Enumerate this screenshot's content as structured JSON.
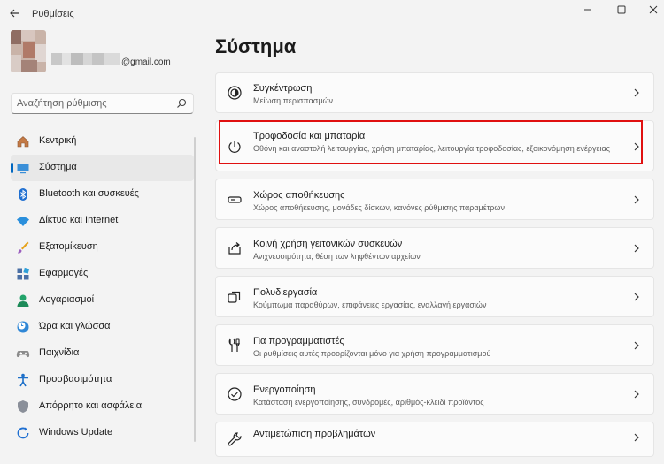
{
  "window": {
    "title": "Ρυθμίσεις",
    "back_icon": "arrow-left-icon",
    "controls": [
      "minimize-icon",
      "maximize-icon",
      "close-icon"
    ]
  },
  "profile": {
    "email": "@gmail.com"
  },
  "search": {
    "placeholder": "Αναζήτηση ρύθμισης",
    "icon": "search-icon"
  },
  "sidebar": {
    "items": [
      {
        "label": "Κεντρική",
        "icon": "home-icon"
      },
      {
        "label": "Σύστημα",
        "icon": "monitor-icon",
        "selected": true
      },
      {
        "label": "Bluetooth και συσκευές",
        "icon": "bluetooth-icon"
      },
      {
        "label": "Δίκτυο και Internet",
        "icon": "wifi-icon"
      },
      {
        "label": "Εξατομίκευση",
        "icon": "brush-icon"
      },
      {
        "label": "Εφαρμογές",
        "icon": "apps-icon"
      },
      {
        "label": "Λογαριασμοί",
        "icon": "account-icon"
      },
      {
        "label": "Ώρα και γλώσσα",
        "icon": "clock-globe-icon"
      },
      {
        "label": "Παιχνίδια",
        "icon": "gamepad-icon"
      },
      {
        "label": "Προσβασιμότητα",
        "icon": "accessibility-icon"
      },
      {
        "label": "Απόρρητο και ασφάλεια",
        "icon": "shield-icon"
      },
      {
        "label": "Windows Update",
        "icon": "update-icon"
      }
    ]
  },
  "main": {
    "title": "Σύστημα",
    "cards": [
      {
        "title": "Συγκέντρωση",
        "desc": "Μείωση περισπασμών",
        "icon": "focus-icon"
      },
      {
        "title": "Τροφοδοσία και μπαταρία",
        "desc": "Οθόνη και αναστολή λειτουργίας, χρήση μπαταρίας, λειτουργία τροφοδοσίας, εξοικονόμηση ενέργειας",
        "icon": "power-icon"
      },
      {
        "title": "Χώρος αποθήκευσης",
        "desc": "Χώρος αποθήκευσης, μονάδες δίσκων, κανόνες ρύθμισης παραμέτρων",
        "icon": "storage-icon"
      },
      {
        "title": "Κοινή χρήση γειτονικών συσκευών",
        "desc": "Ανιχνευσιμότητα, θέση των ληφθέντων αρχείων",
        "icon": "share-icon"
      },
      {
        "title": "Πολυδιεργασία",
        "desc": "Κούμπωμα παραθύρων, επιφάνειες εργασίας, εναλλαγή εργασιών",
        "icon": "multitask-icon"
      },
      {
        "title": "Για προγραμματιστές",
        "desc": "Οι ρυθμίσεις αυτές προορίζονται μόνο για χρήση προγραμματισμού",
        "icon": "developer-icon"
      },
      {
        "title": "Ενεργοποίηση",
        "desc": "Κατάσταση ενεργοποίησης, συνδρομές, αριθμός-κλειδί προϊόντος",
        "icon": "activation-icon"
      },
      {
        "title": "Αντιμετώπιση προβλημάτων",
        "desc": "",
        "icon": "wrench-icon"
      }
    ]
  },
  "colors": {
    "accent": "#0067c0",
    "highlight": "#e01010",
    "background": "#f3f3f3",
    "card": "#fbfbfb"
  }
}
